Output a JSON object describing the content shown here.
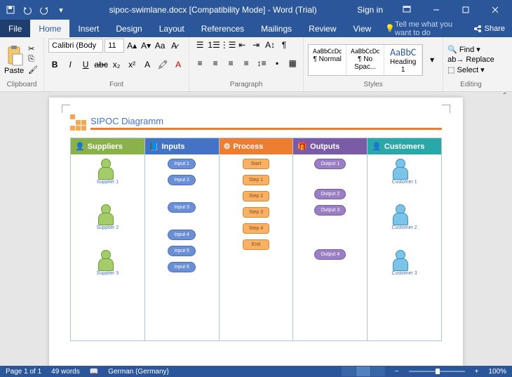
{
  "titlebar": {
    "doc_title": "sipoc-swimlane.docx [Compatibility Mode] - Word (Trial)",
    "signin": "Sign in"
  },
  "tabs": {
    "file": "File",
    "home": "Home",
    "insert": "Insert",
    "design": "Design",
    "layout": "Layout",
    "references": "References",
    "mailings": "Mailings",
    "review": "Review",
    "view": "View",
    "tellme": "Tell me what you want to do",
    "share": "Share"
  },
  "ribbon": {
    "clipboard": {
      "paste": "Paste",
      "label": "Clipboard"
    },
    "font": {
      "name": "Calibri (Body",
      "size": "11",
      "label": "Font"
    },
    "paragraph": {
      "label": "Paragraph"
    },
    "styles": {
      "label": "Styles",
      "items": [
        {
          "preview": "AaBbCcDc",
          "name": "¶ Normal"
        },
        {
          "preview": "AaBbCcDc",
          "name": "¶ No Spac..."
        },
        {
          "preview": "AaBbC",
          "name": "Heading 1"
        }
      ]
    },
    "editing": {
      "find": "Find",
      "replace": "Replace",
      "select": "Select",
      "label": "Editing"
    }
  },
  "document": {
    "title": "SIPOC Diagramm",
    "lanes": {
      "suppliers": {
        "head": "Suppliers",
        "items": [
          "Supplier 1",
          "Supplier 2",
          "Supplier 3"
        ]
      },
      "inputs": {
        "head": "Inputs",
        "items": [
          "Input 1",
          "Input 2",
          "Input 3",
          "Input 4",
          "Input 5",
          "Input 6"
        ]
      },
      "process": {
        "head": "Process",
        "items": [
          "Start",
          "Step 1",
          "Step 2",
          "Step 3",
          "Step 4",
          "End"
        ]
      },
      "outputs": {
        "head": "Outputs",
        "items": [
          "Output 1",
          "Output 2",
          "Output 3",
          "Output 4"
        ]
      },
      "customers": {
        "head": "Customers",
        "items": [
          "Customer 1",
          "Customer 2",
          "Customer 3"
        ]
      }
    }
  },
  "statusbar": {
    "page": "Page 1 of 1",
    "words": "49 words",
    "lang": "German (Germany)",
    "zoom": "100%"
  }
}
